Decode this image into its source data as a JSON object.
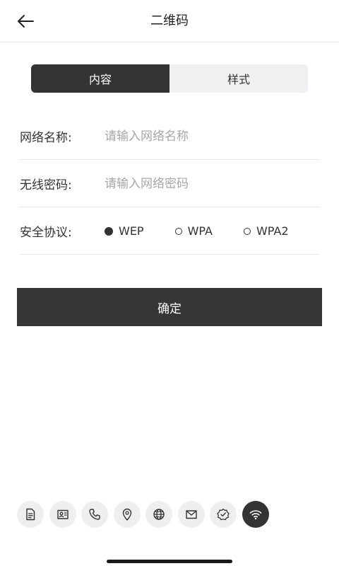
{
  "header": {
    "back_icon": "arrow-left-icon",
    "title": "二维码"
  },
  "tabs": [
    {
      "label": "内容",
      "active": true
    },
    {
      "label": "样式",
      "active": false
    }
  ],
  "form": {
    "ssid": {
      "label": "网络名称:",
      "placeholder": "请输入网络名称",
      "value": ""
    },
    "password": {
      "label": "无线密码:",
      "placeholder": "请输入网络密码",
      "value": ""
    },
    "security": {
      "label": "安全协议:",
      "options": [
        "WEP",
        "WPA",
        "WPA2"
      ],
      "selected": "WEP"
    }
  },
  "confirm_label": "确定",
  "qr_types": [
    {
      "icon": "document-icon"
    },
    {
      "icon": "contact-card-icon"
    },
    {
      "icon": "phone-icon"
    },
    {
      "icon": "location-pin-icon"
    },
    {
      "icon": "globe-icon"
    },
    {
      "icon": "mail-icon"
    },
    {
      "icon": "verified-badge-icon"
    },
    {
      "icon": "wifi-icon",
      "active": true
    }
  ],
  "colors": {
    "accent": "#333333",
    "tab_inactive_bg": "#f0f0f2",
    "icon_bg": "#efefef"
  }
}
